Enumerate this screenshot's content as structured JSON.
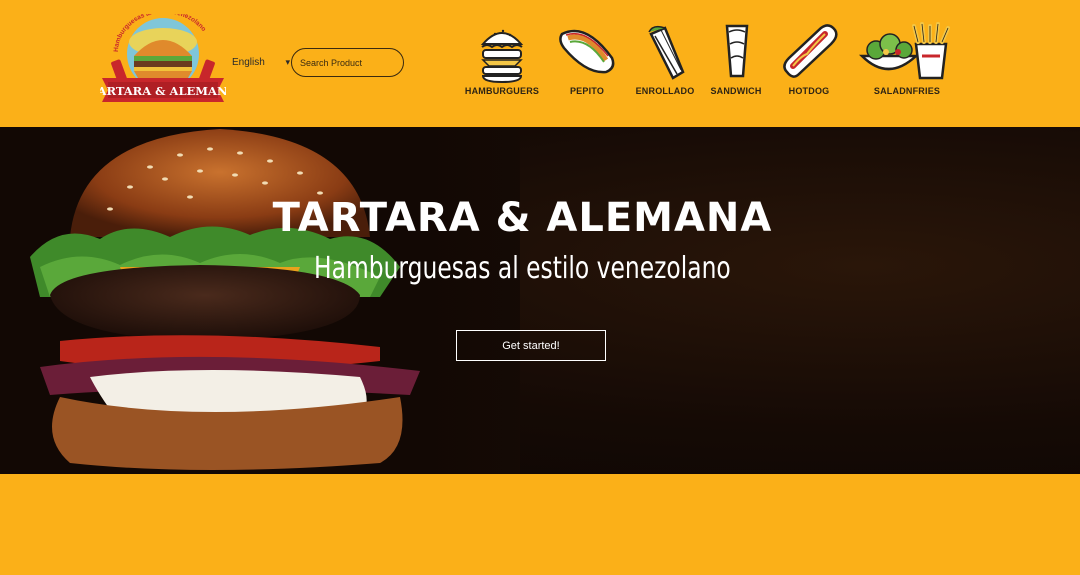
{
  "brand": {
    "name": "TARTARA & ALEMANA",
    "tagline": "Hamburguesas al Estilo Venezolano",
    "colors": {
      "accent": "#fbb018",
      "ribbon": "#c8262b",
      "hero_bg": "#150a05"
    }
  },
  "header": {
    "language": {
      "selected": "English",
      "icon": "chevron-down-icon"
    },
    "search": {
      "placeholder": "Search Product",
      "value": ""
    },
    "categories": [
      {
        "label": "HAMBURGUERS",
        "icon": "hamburger-icon"
      },
      {
        "label": "PEPITO",
        "icon": "pepito-icon"
      },
      {
        "label": "ENROLLADO",
        "icon": "wrap-icon"
      },
      {
        "label": "SANDWICH",
        "icon": "sandwich-icon"
      },
      {
        "label": "HOTDOG",
        "icon": "hotdog-icon"
      },
      {
        "label": "SALADNFRIES",
        "icon": "salad-fries-icon"
      }
    ]
  },
  "hero": {
    "title": "TARTARA & ALEMANA",
    "subtitle": "Hamburguesas al estilo venezolano",
    "cta_label": "Get started!"
  }
}
